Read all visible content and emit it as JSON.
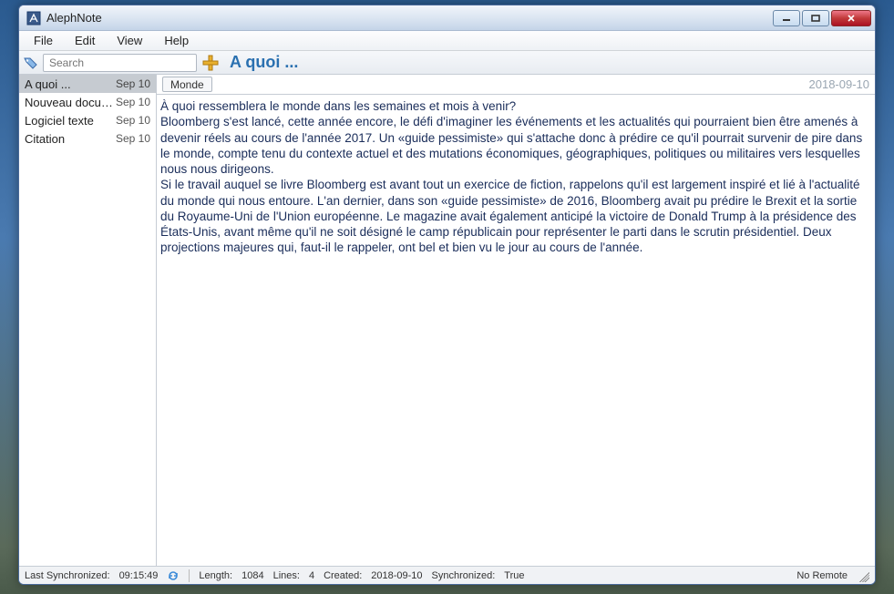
{
  "window": {
    "title": "AlephNote"
  },
  "menu": {
    "file": "File",
    "edit": "Edit",
    "view": "View",
    "help": "Help"
  },
  "toolbar": {
    "search_placeholder": "Search",
    "note_title": "A quoi ..."
  },
  "sidebar": {
    "items": [
      {
        "name": "A quoi ...",
        "date": "Sep 10",
        "selected": true
      },
      {
        "name": "Nouveau docume...",
        "date": "Sep 10",
        "selected": false
      },
      {
        "name": "Logiciel texte",
        "date": "Sep 10",
        "selected": false
      },
      {
        "name": "Citation",
        "date": "Sep 10",
        "selected": false
      }
    ]
  },
  "editor": {
    "tag": "Monde",
    "date": "2018-09-10",
    "body": "À quoi ressemblera le monde dans les semaines et mois à venir?\nBloomberg s'est lancé, cette année encore, le défi d'imaginer les événements et les actualités qui pourraient bien être amenés à devenir réels au cours de l'année 2017. Un «guide pessimiste» qui s'attache donc à prédire ce qu'il pourrait survenir de pire dans le monde, compte tenu du contexte actuel et des mutations économiques, géographiques, politiques ou militaires vers lesquelles nous nous dirigeons.\nSi le travail auquel se livre Bloomberg est avant tout un exercice de fiction, rappelons qu'il est largement inspiré et lié à l'actualité du monde qui nous entoure. L'an dernier, dans son «guide pessimiste» de 2016, Bloomberg avait pu prédire le Brexit et la sortie du Royaume-Uni de l'Union européenne. Le magazine avait également anticipé la victoire de Donald Trump à la présidence des États-Unis, avant même qu'il ne soit désigné le camp républicain pour représenter le parti dans le scrutin présidentiel. Deux projections majeures qui, faut-il le rappeler, ont bel et bien vu le jour au cours de l'année."
  },
  "status": {
    "last_sync_label": "Last Synchronized:",
    "last_sync_value": "09:15:49",
    "length_label": "Length:",
    "length_value": "1084",
    "lines_label": "Lines:",
    "lines_value": "4",
    "created_label": "Created:",
    "created_value": "2018-09-10",
    "synchronized_label": "Synchronized:",
    "synchronized_value": "True",
    "remote": "No Remote"
  }
}
